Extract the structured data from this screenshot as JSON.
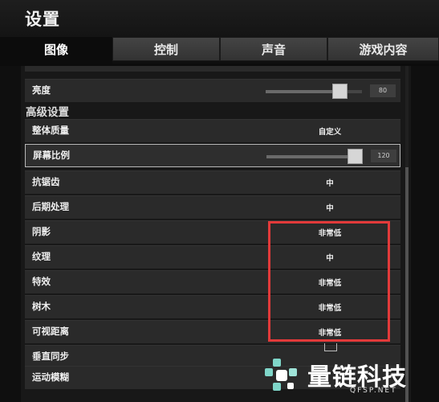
{
  "window": {
    "title": "设置"
  },
  "tabs": [
    {
      "label": "图像",
      "active": true
    },
    {
      "label": "控制",
      "active": false
    },
    {
      "label": "声音",
      "active": false
    },
    {
      "label": "游戏内容",
      "active": false
    }
  ],
  "brightness": {
    "label": "亮度",
    "value": "80",
    "fraction": 0.82
  },
  "advanced_section": {
    "title": "高级设置"
  },
  "settings": [
    {
      "label": "整体质量",
      "value": "自定义"
    },
    {
      "label": "屏幕比例",
      "value": "120",
      "fraction": 1.0
    },
    {
      "label": "抗锯齿",
      "value": "中"
    },
    {
      "label": "后期处理",
      "value": "中"
    },
    {
      "label": "阴影",
      "value": "非常低"
    },
    {
      "label": "纹理",
      "value": "中"
    },
    {
      "label": "特效",
      "value": "非常低"
    },
    {
      "label": "树木",
      "value": "非常低"
    },
    {
      "label": "可视距离",
      "value": "非常低"
    },
    {
      "label": "垂直同步",
      "value": ""
    },
    {
      "label": "运动模糊",
      "value": ""
    }
  ],
  "watermark": {
    "text": "量链科技",
    "sub": "QFSP.NET"
  },
  "colors": {
    "highlight": "#e23a3a",
    "background": "#0f0f0f",
    "row": "#2a2a2a"
  }
}
